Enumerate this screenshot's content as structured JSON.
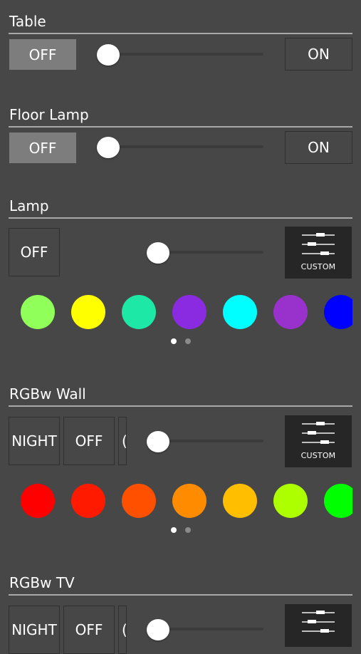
{
  "devices": {
    "table": {
      "title": "Table",
      "off_label": "OFF",
      "on_label": "ON",
      "level_fraction": 0.0
    },
    "floor_lamp": {
      "title": "Floor Lamp",
      "off_label": "OFF",
      "on_label": "ON",
      "level_fraction": 0.0
    },
    "lamp": {
      "title": "Lamp",
      "off_label": "OFF",
      "custom_label": "CUSTOM",
      "level_fraction": 0.0,
      "colors": [
        "#90ff5a",
        "#ffff00",
        "#1de8a6",
        "#8a2be2",
        "#00ffff",
        "#9932cc",
        "#0000ff"
      ],
      "page_dots": [
        "on",
        "off"
      ]
    },
    "rgbw_wall": {
      "title": "RGBw Wall",
      "night_label": "NIGHT",
      "off_label": "OFF",
      "custom_label": "CUSTOM",
      "level_fraction": 0.0,
      "colors": [
        "#ff0000",
        "#ff1a00",
        "#ff5000",
        "#ff8c00",
        "#ffbf00",
        "#adff00",
        "#00ff00"
      ],
      "page_dots": [
        "on",
        "off"
      ]
    },
    "rgbw_tv": {
      "title": "RGBw TV",
      "night_label": "NIGHT",
      "off_label": "OFF",
      "level_fraction": 0.0
    }
  },
  "icons": {
    "custom": "equalizer-sliders-icon",
    "knob": "slider-knob"
  }
}
